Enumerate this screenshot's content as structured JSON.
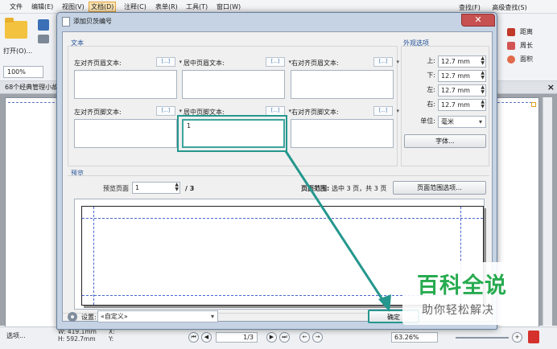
{
  "menubar": {
    "items": [
      "文件",
      "编辑(E)",
      "视图(V)",
      "文档(D)",
      "注释(C)",
      "表单(R)",
      "工具(T)",
      "窗口(W)"
    ],
    "active_index": 3
  },
  "toolbar": {
    "open_label": "打开(O)...",
    "zoom_value": "100%",
    "find_label": "查找(F)",
    "advanced_find_label": "高级查找(S)",
    "right_tools": [
      "距离",
      "周长",
      "面积"
    ]
  },
  "document": {
    "tab_label": "68个经典管理小故"
  },
  "dialog": {
    "title": "添加贝茨编号",
    "close_symbol": "✕",
    "text_group_label": "文本",
    "insert_button_text": "[...]",
    "fields": [
      {
        "label": "左对齐页眉文本:",
        "value": ""
      },
      {
        "label": "居中页眉文本:",
        "value": ""
      },
      {
        "label": "右对齐页眉文本:",
        "value": ""
      },
      {
        "label": "左对齐页脚文本:",
        "value": ""
      },
      {
        "label": "居中页脚文本:",
        "value": "1"
      },
      {
        "label": "右对齐页脚文本:",
        "value": ""
      }
    ],
    "appearance": {
      "label": "外观选项",
      "top_label": "上:",
      "top_value": "12.7 mm",
      "bottom_label": "下:",
      "bottom_value": "12.7 mm",
      "left_label": "左:",
      "left_value": "12.7 mm",
      "right_label": "右:",
      "right_value": "12.7 mm",
      "unit_label": "单位:",
      "unit_value": "毫米",
      "font_button": "字体..."
    },
    "preview": {
      "label": "预览",
      "page_label": "预览页面",
      "page_value": "1",
      "page_total": "/ 3",
      "range_label": "页面范围:",
      "range_text": "选中 3 页，共 3 页",
      "range_button": "页面范围选项..."
    },
    "settings": {
      "label": "设置:",
      "value": "«自定义»"
    },
    "ok_button": "确定"
  },
  "statusbar": {
    "select_label": "选项...",
    "width_text": "W: 419.1mm",
    "height_text": "H: 592.7mm",
    "x_label": "X:",
    "y_label": "Y:",
    "page_value": "1/3",
    "zoom_value": "63.26%"
  },
  "watermark": {
    "logo": "百科全说",
    "slogan": "助你轻松解决"
  },
  "colors": {
    "highlight": "#25978e",
    "accent": "#1f4f96",
    "watermark_green": "#27ab50"
  }
}
